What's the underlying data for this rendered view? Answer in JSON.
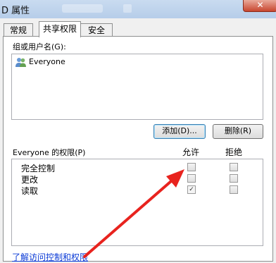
{
  "window": {
    "title": "D 属性",
    "close_symbol": "✕"
  },
  "tabs": [
    {
      "label": "常规",
      "active": false
    },
    {
      "label": "共享权限",
      "active": true
    },
    {
      "label": "安全",
      "active": false
    }
  ],
  "users_section": {
    "label": "组或用户名(G):",
    "users": [
      {
        "name": "Everyone",
        "icon": "users-group-icon"
      }
    ],
    "add_button": "添加(D)...",
    "remove_button": "删除(R)"
  },
  "permissions_section": {
    "label": "Everyone 的权限(P)",
    "allow_header": "允许",
    "deny_header": "拒绝",
    "rows": [
      {
        "name": "完全控制",
        "allow": false,
        "deny": false
      },
      {
        "name": "更改",
        "allow": false,
        "deny": false
      },
      {
        "name": "读取",
        "allow": true,
        "deny": false
      }
    ]
  },
  "help_link": "了解访问控制和权限",
  "annotation": {
    "color": "#e8231e"
  }
}
